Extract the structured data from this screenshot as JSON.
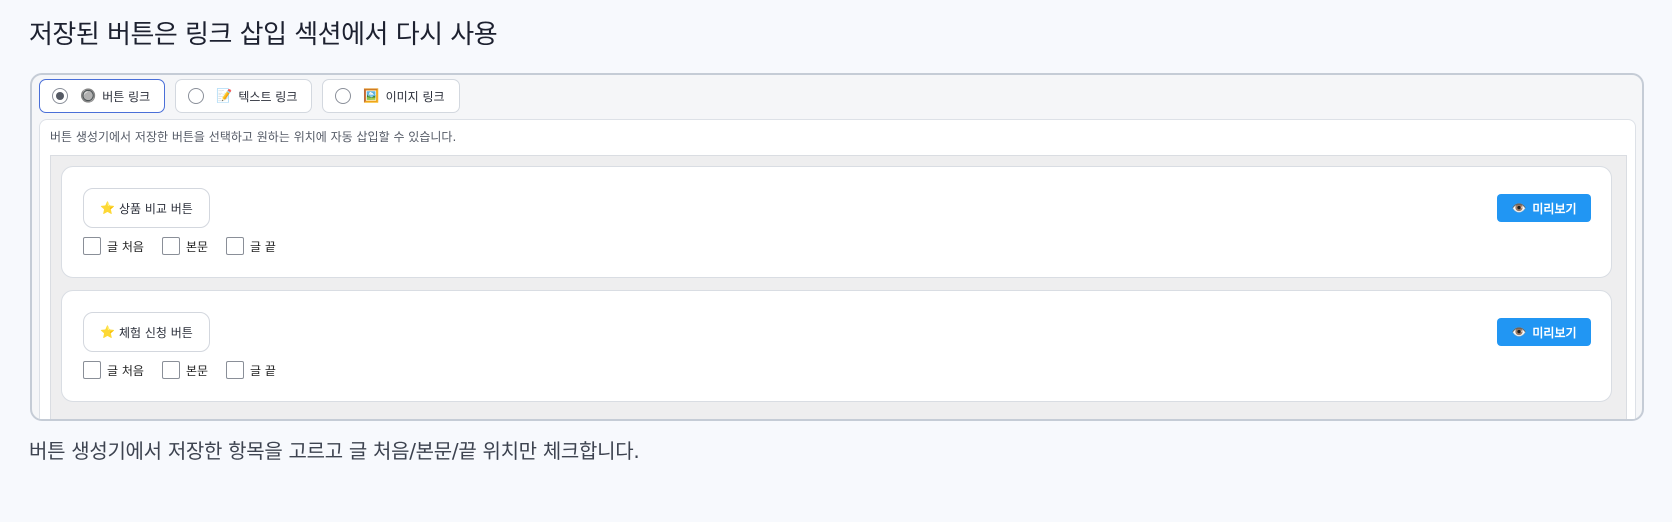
{
  "page": {
    "title": "저장된 버튼은 링크 삽입 섹션에서 다시 사용",
    "footer_note": "버튼 생성기에서 저장한 항목을 고르고 글 처음/본문/끝 위치만 체크합니다."
  },
  "tabs": [
    {
      "emoji": "🔘",
      "label": "버튼 링크",
      "selected": true
    },
    {
      "emoji": "📝",
      "label": "텍스트 링크",
      "selected": false
    },
    {
      "emoji": "🖼️",
      "label": "이미지 링크",
      "selected": false
    }
  ],
  "panel": {
    "description": "버튼 생성기에서 저장한 버튼을 선택하고 원하는 위치에 자동 삽입할 수 있습니다."
  },
  "items": [
    {
      "icon": "⭐",
      "name": "상품 비교 버튼",
      "preview": {
        "icon": "👁️",
        "label": "미리보기"
      },
      "positions": [
        {
          "label": "글 처음",
          "checked": false
        },
        {
          "label": "본문",
          "checked": false
        },
        {
          "label": "글 끝",
          "checked": false
        }
      ]
    },
    {
      "icon": "⭐",
      "name": "체험 신청 버튼",
      "preview": {
        "icon": "👁️",
        "label": "미리보기"
      },
      "positions": [
        {
          "label": "글 처음",
          "checked": false
        },
        {
          "label": "본문",
          "checked": false
        },
        {
          "label": "글 끝",
          "checked": false
        }
      ]
    }
  ],
  "colors": {
    "accent": "#2196f3",
    "active_tab_border": "#4a6fd8",
    "background": "#f7f9fd"
  }
}
